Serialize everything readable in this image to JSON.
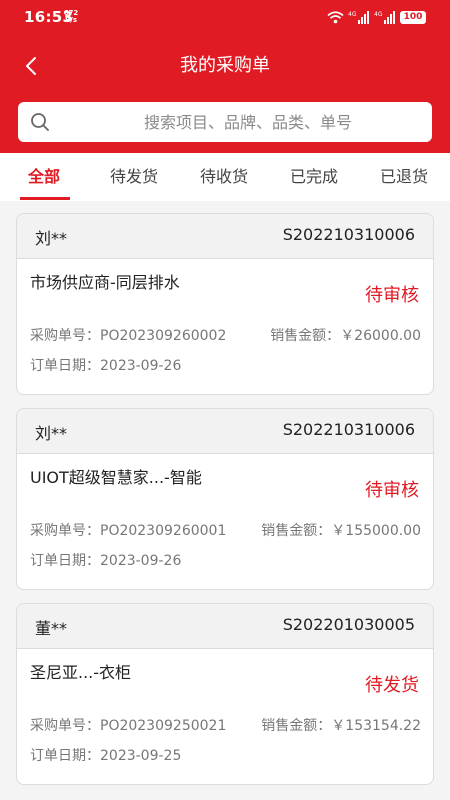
{
  "status_bar": {
    "time": "16:53",
    "net_speed_value": "672",
    "net_speed_unit": "B/s",
    "battery": "100",
    "signal_labels": [
      "4G",
      "4G"
    ]
  },
  "nav": {
    "title": "我的采购单",
    "back_icon": "chevron-left-icon"
  },
  "search": {
    "placeholder": "搜索项目、品牌、品类、单号",
    "value": ""
  },
  "tabs": [
    {
      "label": "全部",
      "active": true
    },
    {
      "label": "待发货",
      "active": false
    },
    {
      "label": "待收货",
      "active": false
    },
    {
      "label": "已完成",
      "active": false
    },
    {
      "label": "已退货",
      "active": false
    }
  ],
  "orders": [
    {
      "customer": "刘**",
      "code": "S202210310006",
      "product": "市场供应商-同层排水",
      "status": "待审核",
      "po_label": "采购单号：",
      "po_number": "PO202309260002",
      "amount_label": "销售金额：",
      "amount": "￥26000.00",
      "date_label": "订单日期：",
      "date": "2023-09-26"
    },
    {
      "customer": "刘**",
      "code": "S202210310006",
      "product": "UIOT超级智慧家...-智能",
      "status": "待审核",
      "po_label": "采购单号：",
      "po_number": "PO202309260001",
      "amount_label": "销售金额：",
      "amount": "￥155000.00",
      "date_label": "订单日期：",
      "date": "2023-09-26"
    },
    {
      "customer": "董**",
      "code": "S202201030005",
      "product": "圣尼亚...-衣柜",
      "status": "待发货",
      "po_label": "采购单号：",
      "po_number": "PO202309250021",
      "amount_label": "销售金额：",
      "amount": "￥153154.22",
      "date_label": "订单日期：",
      "date": "2023-09-25"
    }
  ],
  "colors": {
    "brand_red": "#e01b24",
    "background": "#f4f4f4"
  }
}
